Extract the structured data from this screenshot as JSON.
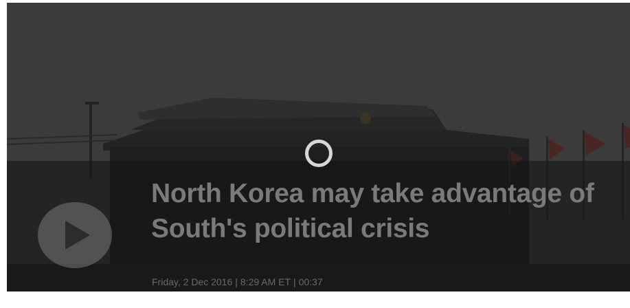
{
  "video": {
    "title": "North Korea may take advantage of South's political crisis",
    "date": "Friday, 2 Dec 2016",
    "time": "8:29 AM ET",
    "duration": "00:37",
    "separator": "|"
  },
  "icons": {
    "play": "play-icon",
    "loading": "loading-spinner-icon"
  },
  "colors": {
    "overlay": "#161616",
    "headline": "#7a7a7a",
    "meta": "#6a6a6a",
    "spinner": "#d7d7d7"
  }
}
